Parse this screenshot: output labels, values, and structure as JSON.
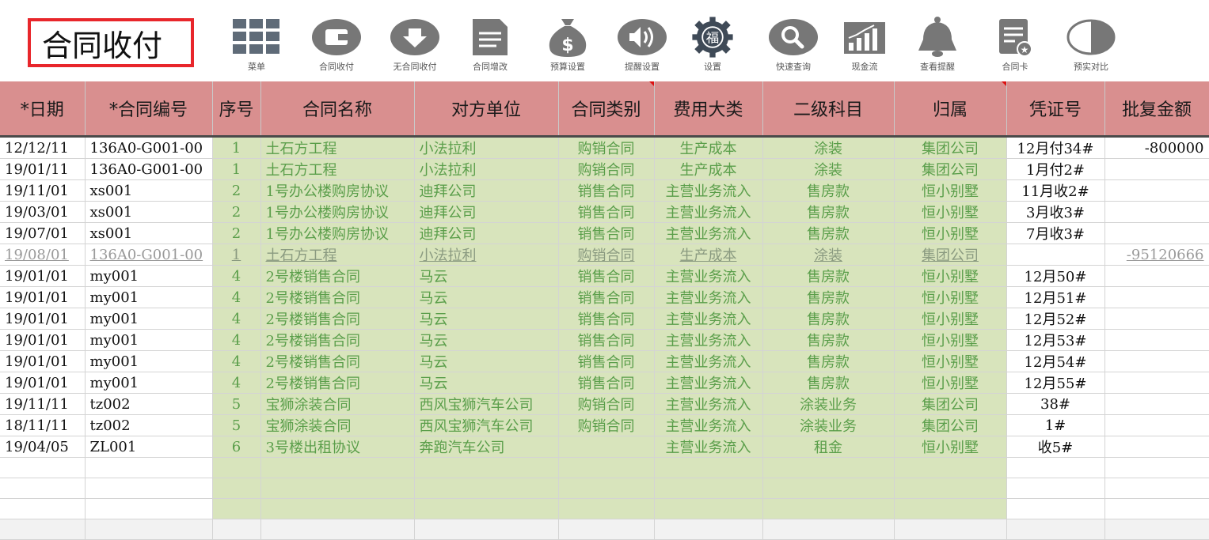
{
  "title": "合同收付",
  "toolbar": [
    {
      "label": "菜单",
      "icon": "grid-menu-icon"
    },
    {
      "label": "合同收付",
      "icon": "wallet-icon"
    },
    {
      "label": "无合同收付",
      "icon": "download-icon"
    },
    {
      "label": "合同增改",
      "icon": "document-icon"
    },
    {
      "label": "预算设置",
      "icon": "money-bag-icon"
    },
    {
      "label": "提醒设置",
      "icon": "speaker-icon"
    },
    {
      "label": "设置",
      "icon": "gear-icon"
    },
    {
      "label": "快速查询",
      "icon": "magnifier-icon"
    },
    {
      "label": "现金流",
      "icon": "bar-chart-icon"
    },
    {
      "label": "查看提醒",
      "icon": "bell-icon"
    },
    {
      "label": "合同卡",
      "icon": "contract-card-icon"
    },
    {
      "label": "预实对比",
      "icon": "half-circle-icon"
    }
  ],
  "columns": [
    "*日期",
    "*合同编号",
    "序号",
    "合同名称",
    "对方单位",
    "合同类别",
    "费用大类",
    "二级科目",
    "归属",
    "凭证号",
    "批复金额"
  ],
  "rows": [
    [
      "12/12/11",
      "136A0-G001-00",
      "1",
      "土石方工程",
      "小法拉利",
      "购销合同",
      "生产成本",
      "涂装",
      "集团公司",
      "12月付34#",
      "-800000"
    ],
    [
      "19/01/11",
      "136A0-G001-00",
      "1",
      "土石方工程",
      "小法拉利",
      "购销合同",
      "生产成本",
      "涂装",
      "集团公司",
      "1月付2#",
      ""
    ],
    [
      "19/11/01",
      "xs001",
      "2",
      "1号办公楼购房协议",
      "迪拜公司",
      "销售合同",
      "主营业务流入",
      "售房款",
      "恒小别墅",
      "11月收2#",
      ""
    ],
    [
      "19/03/01",
      "xs001",
      "2",
      "1号办公楼购房协议",
      "迪拜公司",
      "销售合同",
      "主营业务流入",
      "售房款",
      "恒小别墅",
      "3月收3#",
      ""
    ],
    [
      "19/07/01",
      "xs001",
      "2",
      "1号办公楼购房协议",
      "迪拜公司",
      "销售合同",
      "主营业务流入",
      "售房款",
      "恒小别墅",
      "7月收3#",
      ""
    ],
    [
      "19/08/01",
      "136A0-G001-00",
      "1",
      "土石方工程",
      "小法拉利",
      "购销合同",
      "生产成本",
      "涂装",
      "集团公司",
      "",
      "-95120666"
    ],
    [
      "19/01/01",
      "my001",
      "4",
      "2号楼销售合同",
      "马云",
      "销售合同",
      "主营业务流入",
      "售房款",
      "恒小别墅",
      "12月50#",
      ""
    ],
    [
      "19/01/01",
      "my001",
      "4",
      "2号楼销售合同",
      "马云",
      "销售合同",
      "主营业务流入",
      "售房款",
      "恒小别墅",
      "12月51#",
      ""
    ],
    [
      "19/01/01",
      "my001",
      "4",
      "2号楼销售合同",
      "马云",
      "销售合同",
      "主营业务流入",
      "售房款",
      "恒小别墅",
      "12月52#",
      ""
    ],
    [
      "19/01/01",
      "my001",
      "4",
      "2号楼销售合同",
      "马云",
      "销售合同",
      "主营业务流入",
      "售房款",
      "恒小别墅",
      "12月53#",
      ""
    ],
    [
      "19/01/01",
      "my001",
      "4",
      "2号楼销售合同",
      "马云",
      "销售合同",
      "主营业务流入",
      "售房款",
      "恒小别墅",
      "12月54#",
      ""
    ],
    [
      "19/01/01",
      "my001",
      "4",
      "2号楼销售合同",
      "马云",
      "销售合同",
      "主营业务流入",
      "售房款",
      "恒小别墅",
      "12月55#",
      ""
    ],
    [
      "19/11/11",
      "tz002",
      "5",
      "宝狮涂装合同",
      "西风宝狮汽车公司",
      "购销合同",
      "主营业务流入",
      "涂装业务",
      "集团公司",
      "38#",
      ""
    ],
    [
      "18/11/11",
      "tz002",
      "5",
      "宝狮涂装合同",
      "西风宝狮汽车公司",
      "购销合同",
      "主营业务流入",
      "涂装业务",
      "集团公司",
      "1#",
      ""
    ],
    [
      "19/04/05",
      "ZL001",
      "6",
      "3号楼出租协议",
      "奔跑汽车公司",
      "",
      "主营业务流入",
      "租金",
      "恒小别墅",
      "收5#",
      ""
    ]
  ],
  "colors": {
    "header_bg": "#d98f8f",
    "green_cell": "#d8e4bc",
    "green_text": "#5a9e4a",
    "icon_gray": "#6d6d6d"
  }
}
